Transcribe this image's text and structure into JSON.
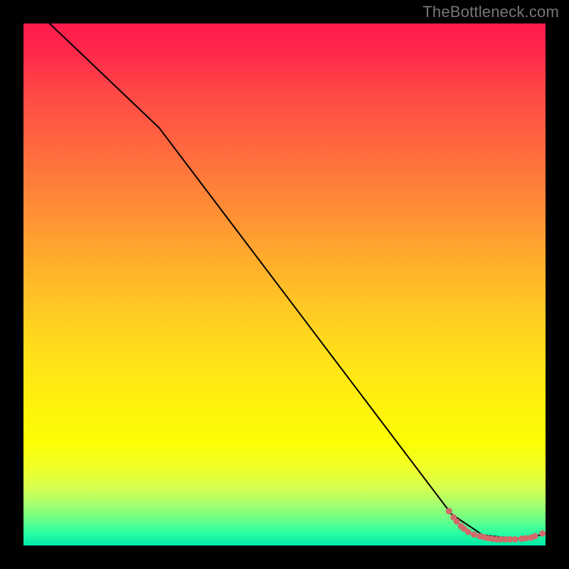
{
  "attribution": "TheBottleneck.com",
  "chart_data": {
    "type": "line",
    "title": "",
    "xlabel": "",
    "ylabel": "",
    "xlim": [
      0,
      100
    ],
    "ylim": [
      0,
      100
    ],
    "series": [
      {
        "name": "curve",
        "x": [
          5,
          26,
          82,
          88,
          95,
          100
        ],
        "y": [
          100,
          80,
          6,
          2,
          1.2,
          2.2
        ]
      }
    ],
    "markers": {
      "name": "dots",
      "points": [
        {
          "x": 81.5,
          "y": 6.6
        },
        {
          "x": 82.4,
          "y": 5.4
        },
        {
          "x": 83.0,
          "y": 4.6
        },
        {
          "x": 83.8,
          "y": 3.7
        },
        {
          "x": 84.4,
          "y": 3.2
        },
        {
          "x": 85.2,
          "y": 2.6
        },
        {
          "x": 86.3,
          "y": 2.1
        },
        {
          "x": 87.4,
          "y": 1.8
        },
        {
          "x": 88.2,
          "y": 1.6
        },
        {
          "x": 89.0,
          "y": 1.4
        },
        {
          "x": 89.8,
          "y": 1.3
        },
        {
          "x": 90.6,
          "y": 1.2
        },
        {
          "x": 91.4,
          "y": 1.2
        },
        {
          "x": 92.3,
          "y": 1.2
        },
        {
          "x": 93.2,
          "y": 1.2
        },
        {
          "x": 94.2,
          "y": 1.2
        },
        {
          "x": 95.4,
          "y": 1.3
        },
        {
          "x": 96.2,
          "y": 1.4
        },
        {
          "x": 97.2,
          "y": 1.5
        },
        {
          "x": 98.0,
          "y": 1.8
        },
        {
          "x": 99.4,
          "y": 2.3
        }
      ]
    }
  }
}
